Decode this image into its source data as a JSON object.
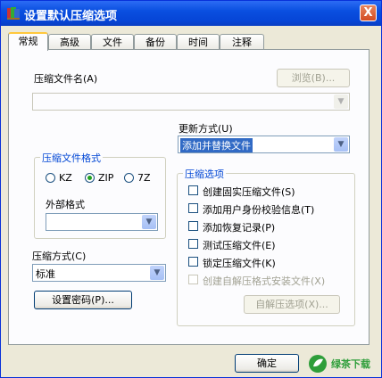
{
  "window": {
    "title": "设置默认压缩选项",
    "close_label": "X"
  },
  "tabs": [
    {
      "label": "常规",
      "active": true
    },
    {
      "label": "高级",
      "active": false
    },
    {
      "label": "文件",
      "active": false
    },
    {
      "label": "备份",
      "active": false
    },
    {
      "label": "时间",
      "active": false
    },
    {
      "label": "注释",
      "active": false
    }
  ],
  "archive_name": {
    "label": "压缩文件名(A)",
    "browse_label": "浏览(B)...",
    "value": ""
  },
  "update_mode": {
    "label": "更新方式(U)",
    "value": "添加并替换文件"
  },
  "format_group": {
    "title": "压缩文件格式",
    "options": [
      {
        "label": "KZ",
        "selected": false
      },
      {
        "label": "ZIP",
        "selected": true
      },
      {
        "label": "7Z",
        "selected": false
      }
    ],
    "external_label": "外部格式",
    "external_value": ""
  },
  "options_group": {
    "title": "压缩选项",
    "items": [
      {
        "label": "创建固实压缩文件(S)",
        "enabled": true
      },
      {
        "label": "添加用户身份校验信息(T)",
        "enabled": true
      },
      {
        "label": "添加恢复记录(P)",
        "enabled": true
      },
      {
        "label": "测试压缩文件(E)",
        "enabled": true
      },
      {
        "label": "锁定压缩文件(K)",
        "enabled": true
      },
      {
        "label": "创建自解压格式安装文件(X)",
        "enabled": false
      }
    ],
    "sfx_button_label": "自解压选项(X)..."
  },
  "compression_method": {
    "label": "压缩方式(C)",
    "value": "标准"
  },
  "password_button_label": "设置密码(P)...",
  "footer": {
    "ok_label": "确定",
    "logo_text": "绿茶下载"
  },
  "colors": {
    "titlebar": "#0a4fe0",
    "accent_tab": "#ffc83c",
    "group_title": "#0046d5",
    "selection": "#316ac5"
  }
}
